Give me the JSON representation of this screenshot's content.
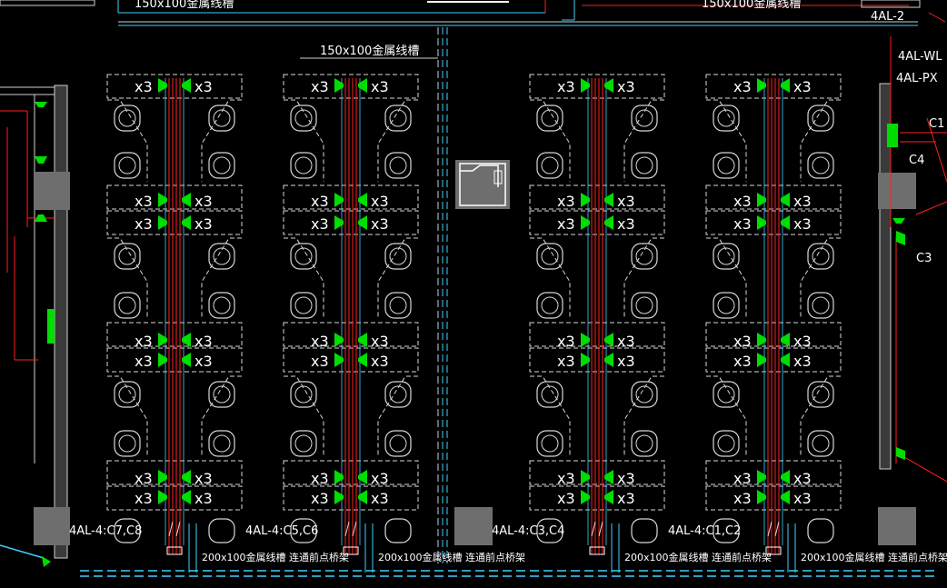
{
  "top": {
    "tray_label_left": "150x100金属线槽",
    "tray_label_right": "150x100金属线槽",
    "panel_label": "4AL-2"
  },
  "tray_main_label": "150x100金属线槽",
  "right_labels": {
    "wl": "4AL-WL",
    "px": "4AL-PX",
    "c1": "C1",
    "c4": "C4",
    "c3": "C3"
  },
  "x3_label": "x3",
  "circuits": [
    "4AL-4:C7,C8",
    "4AL-4:C5,C6",
    "4AL-4:C3,C4",
    "4AL-4:C1,C2"
  ],
  "bottom_tray_label": "200x100金属线槽 连通前点桥架",
  "colors": {
    "outlet": "#00dd00",
    "line_red": "#ff2020",
    "tray_cyan": "#3fd0ff",
    "desk_outline": "#d8d8d8",
    "column_fill": "#6e6e6e"
  }
}
